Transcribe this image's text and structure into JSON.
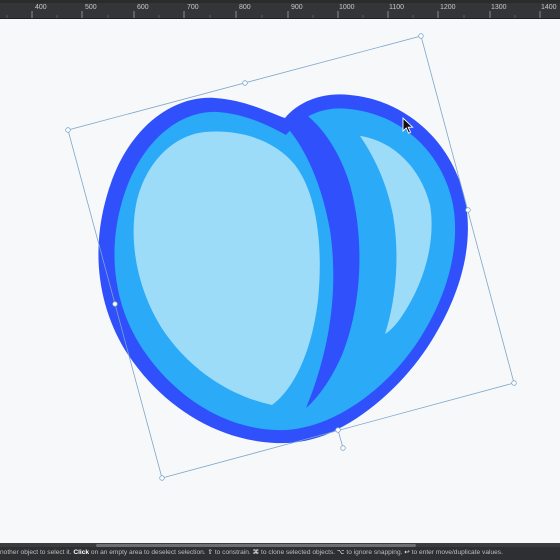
{
  "ruler": {
    "ticks": [
      "400",
      "500",
      "600",
      "700",
      "800",
      "900",
      "1000",
      "1100",
      "1200",
      "1300",
      "1400"
    ]
  },
  "status": {
    "part1": "nother object to select it. ",
    "click_label": "Click",
    "part2": " on an empty area to deselect selection. ",
    "shift_symbol": "⇧",
    "part3": " to constrain. ",
    "cmd_symbol": "⌘",
    "part4": " to clone selected objects. ",
    "opt_symbol": "⌥",
    "part5": " to ignore snapping. ",
    "enter_symbol": "↩",
    "part6": " to enter move/duplicate values."
  },
  "canvas": {
    "shape_name": "heart-shape",
    "selection_state": "selected",
    "colors": {
      "outline": "#2f50fb",
      "mid": "#2baaf7",
      "light": "#9ddcf8",
      "selection": "#7fa6c8",
      "canvas_bg": "#f7f8fa"
    }
  },
  "cursor": {
    "icon": "arrow-cursor-icon"
  }
}
